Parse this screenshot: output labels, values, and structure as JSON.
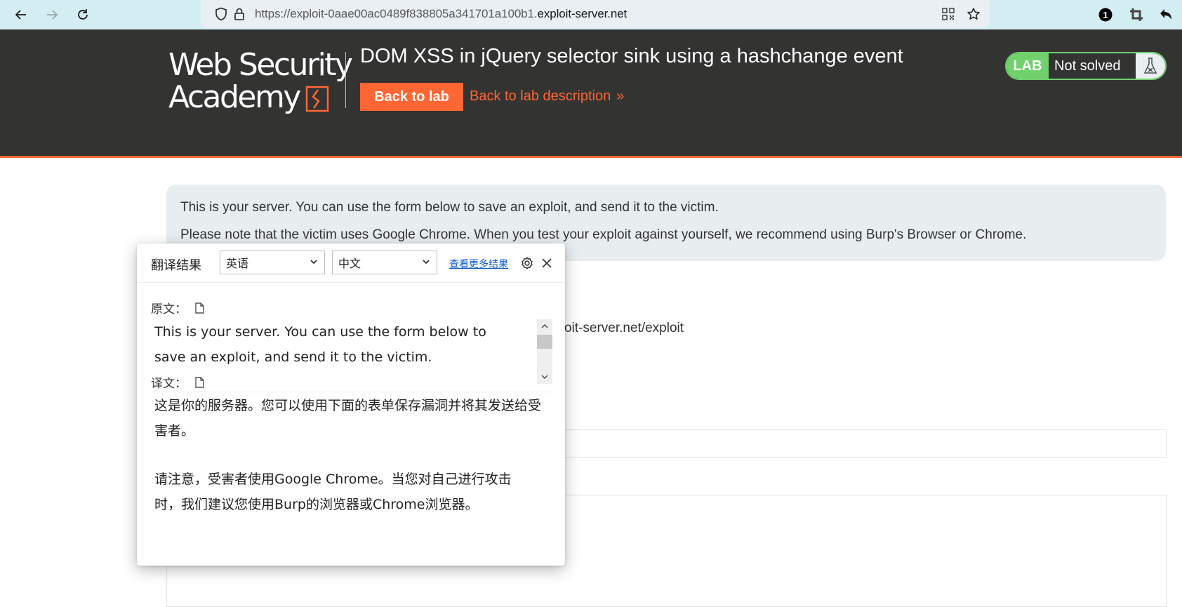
{
  "browser": {
    "url_prefix": "https://exploit-0aae00ac0489f838805a341701a100b1.",
    "url_host": "exploit-server.net",
    "badge_count": "1",
    "icons": [
      "back-arrow-icon",
      "forward-arrow-icon",
      "reload-icon",
      "shield-icon",
      "lock-icon",
      "qr-code-icon",
      "star-icon",
      "extension-badge-icon",
      "crop-icon",
      "undo-icon"
    ]
  },
  "header": {
    "logo_line1": "Web Security",
    "logo_line2": "Academy",
    "lab_title": "DOM XSS in jQuery selector sink using a hashchange event",
    "back_to_lab": "Back to lab",
    "back_to_description": "Back to lab description",
    "chevron": "»",
    "lab_badge": "LAB",
    "lab_status": "Not solved",
    "accent_color": "#ff6633",
    "status_color": "#70d16d"
  },
  "content": {
    "info_line1": "This is your server. You can use the form below to save an exploit, and send it to the victim.",
    "info_line2": "Please note that the victim uses Google Chrome. When you test your exploit against yourself, we recommend using Burp's Browser or Chrome.",
    "partial_url": "oit-server.net/exploit"
  },
  "translate_popup": {
    "title": "翻译结果",
    "source_lang": "英语",
    "target_lang": "中文",
    "more_results": "查看更多结果",
    "source_label": "原文：",
    "source_text": "This is your server. You can use the form below to save an exploit, and send it to the victim.",
    "translation_label": "译文：",
    "translation_p1": "这是你的服务器。您可以使用下面的表单保存漏洞并将其发送给受害者。",
    "translation_p2": "请注意，受害者使用Google Chrome。当您对自己进行攻击时，我们建议您使用Burp的浏览器或Chrome浏览器。"
  }
}
